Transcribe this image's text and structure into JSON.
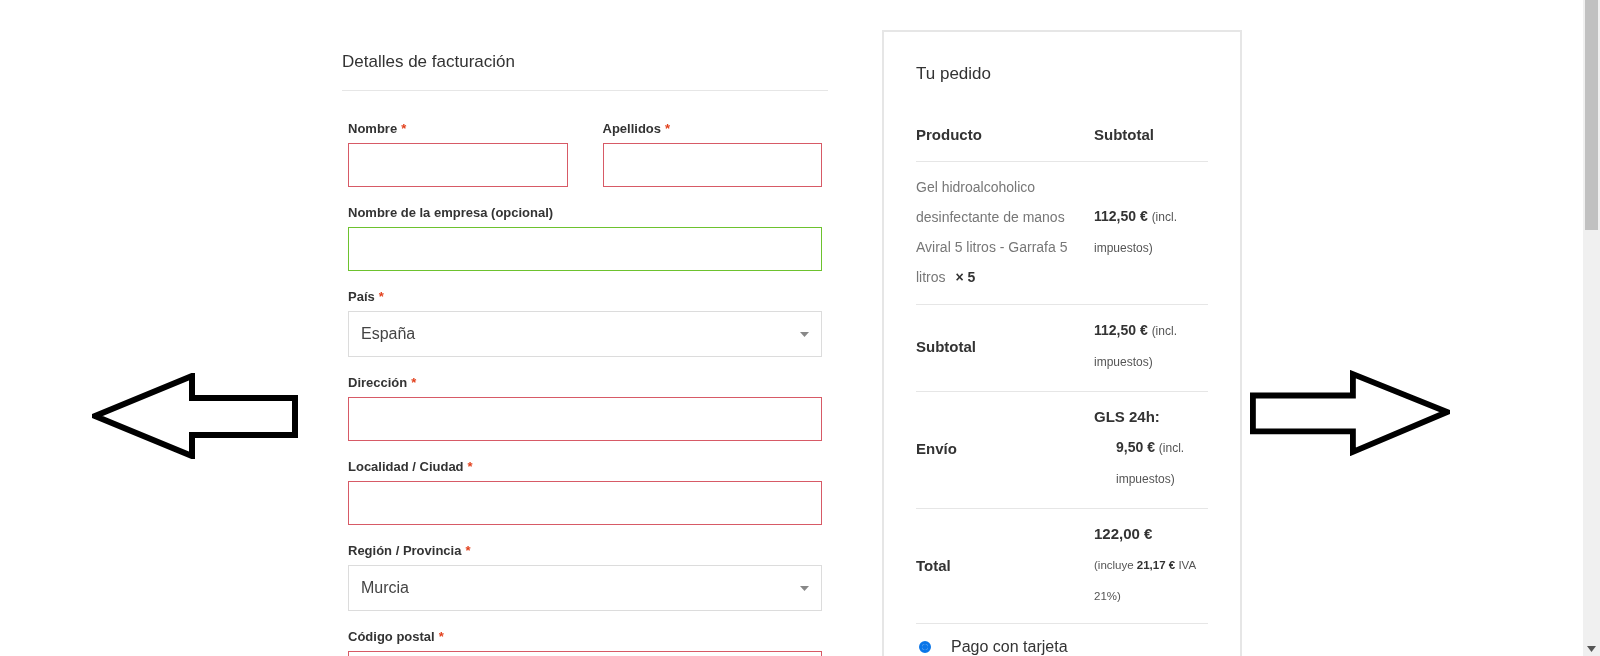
{
  "billing": {
    "title": "Detalles de facturación",
    "rows": [
      {
        "fields": [
          {
            "label": "Nombre",
            "required": "*",
            "kind": "text",
            "invalid": true
          },
          {
            "label": "Apellidos",
            "required": "*",
            "kind": "text",
            "invalid": true
          }
        ]
      },
      {
        "fields": [
          {
            "label": "Nombre de la empresa (opcional)",
            "kind": "text",
            "invalid": false,
            "valid": true
          }
        ]
      },
      {
        "fields": [
          {
            "label": "País",
            "required": "*",
            "kind": "select",
            "value": "España",
            "invalid": false,
            "valid": false
          }
        ]
      },
      {
        "fields": [
          {
            "label": "Dirección",
            "required": "*",
            "kind": "text",
            "invalid": true
          }
        ]
      },
      {
        "fields": [
          {
            "label": "Localidad / Ciudad",
            "required": "*",
            "kind": "text",
            "invalid": true
          }
        ]
      },
      {
        "fields": [
          {
            "label": "Región / Provincia",
            "required": "*",
            "kind": "select",
            "value": "Murcia",
            "invalid": false,
            "valid": false
          }
        ]
      },
      {
        "fields": [
          {
            "label": "Código postal",
            "required": "*",
            "kind": "text",
            "invalid": true
          }
        ]
      }
    ]
  },
  "order": {
    "title": "Tu pedido",
    "columns": [
      "Producto",
      "Subtotal"
    ],
    "rows": [
      {
        "kind": "product",
        "name": "Gel hidroalcoholico desinfectante de manos Aviral 5 litros - Garrafa 5 litros",
        "quantity": "× 5",
        "amount": "112,50 €",
        "note": "(incl. impuestos)"
      },
      {
        "kind": "subtotal",
        "label": "Subtotal",
        "amount": "112,50 €",
        "note": "(incl. impuestos)"
      },
      {
        "kind": "shipping",
        "label": "Envío",
        "method": "GLS 24h:",
        "amount": "9,50 €",
        "note": "(incl. impuestos)"
      },
      {
        "kind": "total",
        "label": "Total",
        "amount": "122,00 €",
        "note": "(incluye **21,17 €** IVA 21%)"
      }
    ],
    "payment_methods": [
      {
        "label": "Pago con tarjeta",
        "selected": true
      }
    ]
  }
}
